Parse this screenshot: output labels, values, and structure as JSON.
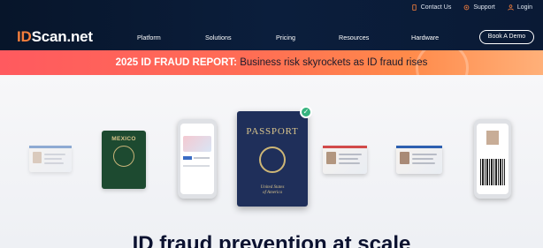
{
  "utility_nav": [
    {
      "label": "Contact Us",
      "icon": "phone-icon"
    },
    {
      "label": "Support",
      "icon": "gear-icon"
    },
    {
      "label": "Login",
      "icon": "user-icon"
    }
  ],
  "brand": {
    "prefix": "ID",
    "name": "Scan.net",
    "accent": "#f47e3c"
  },
  "main_nav": [
    "Platform",
    "Solutions",
    "Pricing",
    "Resources",
    "Hardware"
  ],
  "cta": {
    "label": "Book A Demo"
  },
  "banner": {
    "strong": "2025 ID FRAUD REPORT:",
    "text": " Business risk skyrockets as ID fraud rises"
  },
  "hero": {
    "mexico_label": "MEXICO",
    "passport_title": "PASSPORT",
    "passport_sub": "United States\nof America",
    "headline": "ID fraud prevention at scale"
  },
  "colors": {
    "header_bg": "#0b1e3c",
    "banner_start": "#ff5a5f",
    "banner_end": "#ffb079",
    "check": "#36b37e",
    "passport": "#1f2f5a"
  }
}
